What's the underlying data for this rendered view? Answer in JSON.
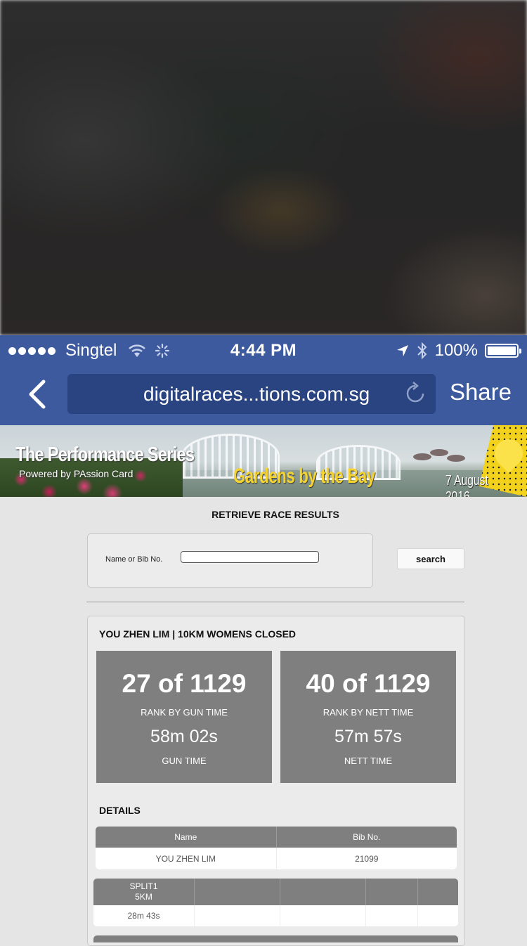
{
  "status_bar": {
    "carrier": "Singtel",
    "time": "4:44 PM",
    "battery": "100%"
  },
  "browser": {
    "url": "digitalraces...tions.com.sg",
    "share_label": "Share"
  },
  "banner": {
    "series_title": "The Performance Series",
    "powered_by": "Powered by PAssion Card",
    "venue": "Gardens by the Bay",
    "date": "7 August 2016"
  },
  "search": {
    "heading": "RETRIEVE RACE RESULTS",
    "label": "Name or Bib No.",
    "input_value": "",
    "button_label": "search"
  },
  "result": {
    "runner_title": "YOU ZHEN LIM | 10KM WOMENS CLOSED",
    "gun": {
      "rank": "27 of 1129",
      "rank_label": "RANK BY GUN TIME",
      "time": "58m 02s",
      "time_label": "GUN TIME"
    },
    "nett": {
      "rank": "40 of 1129",
      "rank_label": "RANK BY NETT TIME",
      "time": "57m 57s",
      "time_label": "NETT TIME"
    },
    "details_heading": "DETAILS",
    "details_table": {
      "headers": [
        "Name",
        "Bib No."
      ],
      "row": [
        "YOU ZHEN LIM",
        "21099"
      ]
    },
    "splits_table": {
      "headers": [
        "SPLIT1\n5KM",
        "",
        "",
        "",
        ""
      ],
      "row": [
        "28m 43s",
        "",
        "",
        "",
        ""
      ]
    }
  }
}
